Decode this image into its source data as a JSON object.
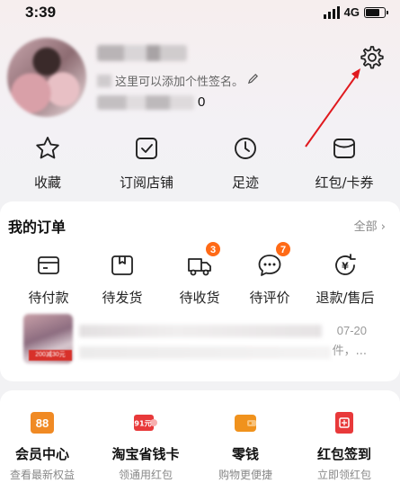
{
  "status_bar": {
    "time": "3:39",
    "network": "4G",
    "battery_level": 0.75
  },
  "profile": {
    "avatar_icon": "avatar",
    "signature": "这里可以添加个性签名。",
    "follow_count": "0"
  },
  "quick_actions": [
    {
      "label": "收藏",
      "icon": "star-icon"
    },
    {
      "label": "订阅店铺",
      "icon": "shop-subscribe-icon"
    },
    {
      "label": "足迹",
      "icon": "clock-icon"
    },
    {
      "label": "红包/卡券",
      "icon": "coupon-icon"
    }
  ],
  "orders": {
    "title": "我的订单",
    "all_link": "全部 ›",
    "items": [
      {
        "label": "待付款",
        "icon": "wallet-icon",
        "badge": ""
      },
      {
        "label": "待发货",
        "icon": "box-icon",
        "badge": ""
      },
      {
        "label": "待收货",
        "icon": "truck-icon",
        "badge": "3"
      },
      {
        "label": "待评价",
        "icon": "comment-icon",
        "badge": "7"
      },
      {
        "label": "退款/售后",
        "icon": "refund-icon",
        "badge": ""
      }
    ],
    "preview": {
      "date": "07-20",
      "ellipsis": "件，...",
      "ribbon": "200减30元"
    }
  },
  "services": [
    {
      "title": "会员中心",
      "subtitle": "查看最新权益",
      "icon_text": "88",
      "color": "#f08a24"
    },
    {
      "title": "淘宝省钱卡",
      "subtitle": "领通用红包",
      "icon_text": "91元",
      "color": "#e8393a"
    },
    {
      "title": "零钱",
      "subtitle": "购物更便捷",
      "icon_text": "",
      "color": "#f0921d"
    },
    {
      "title": "红包签到",
      "subtitle": "立即领红包",
      "icon_text": "",
      "color": "#e8393a"
    }
  ],
  "colors": {
    "badge": "#ff6a16",
    "annotation_arrow": "#e0191e"
  }
}
